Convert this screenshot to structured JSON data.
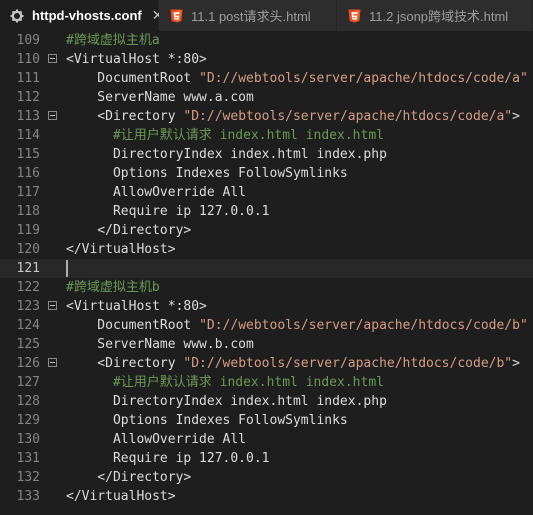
{
  "tabs": [
    {
      "label": "httpd-vhosts.conf",
      "icon": "gear-icon",
      "active": true,
      "close": "✕"
    },
    {
      "label": "11.1 post请求头.html",
      "icon": "html5-icon",
      "active": false
    },
    {
      "label": "11.2 jsonp跨域技术.html",
      "icon": "html5-icon",
      "active": false
    }
  ],
  "colors": {
    "comment": "#6a9955",
    "string": "#d69d85",
    "text": "#dcdcdc",
    "line_number": "#858585",
    "html5_badge": "#e44d26"
  },
  "editor": {
    "lines": [
      {
        "num": "109",
        "segments": [
          {
            "t": "#跨域虚拟主机a",
            "c": "com"
          }
        ]
      },
      {
        "num": "110",
        "fold": true,
        "segments": [
          {
            "t": "<VirtualHost *:80>",
            "c": "tag"
          }
        ]
      },
      {
        "num": "111",
        "segments": [
          {
            "t": "    DocumentRoot ",
            "c": "dir"
          },
          {
            "t": "\"D://webtools/server/apache/htdocs/code/a\"",
            "c": "str"
          }
        ]
      },
      {
        "num": "112",
        "segments": [
          {
            "t": "    ServerName www.a.com",
            "c": "dir"
          }
        ]
      },
      {
        "num": "113",
        "fold": true,
        "segments": [
          {
            "t": "    <Directory ",
            "c": "tag"
          },
          {
            "t": "\"D://webtools/server/apache/htdocs/code/a\"",
            "c": "str"
          },
          {
            "t": ">",
            "c": "tag"
          }
        ]
      },
      {
        "num": "114",
        "segments": [
          {
            "t": "      #让用户默认请求 index.html index.html",
            "c": "com"
          }
        ]
      },
      {
        "num": "115",
        "segments": [
          {
            "t": "      DirectoryIndex index.html index.php",
            "c": "dir"
          }
        ]
      },
      {
        "num": "116",
        "segments": [
          {
            "t": "      Options Indexes FollowSymlinks",
            "c": "dir"
          }
        ]
      },
      {
        "num": "117",
        "segments": [
          {
            "t": "      AllowOverride All",
            "c": "dir"
          }
        ]
      },
      {
        "num": "118",
        "segments": [
          {
            "t": "      Require ip 127.0.0.1",
            "c": "dir"
          }
        ]
      },
      {
        "num": "119",
        "segments": [
          {
            "t": "    </Directory>",
            "c": "tag"
          }
        ]
      },
      {
        "num": "120",
        "segments": [
          {
            "t": "</VirtualHost>",
            "c": "tag"
          }
        ]
      },
      {
        "num": "121",
        "current": true,
        "segments": []
      },
      {
        "num": "122",
        "segments": [
          {
            "t": "#跨域虚拟主机b",
            "c": "com"
          }
        ]
      },
      {
        "num": "123",
        "fold": true,
        "segments": [
          {
            "t": "<VirtualHost *:80>",
            "c": "tag"
          }
        ]
      },
      {
        "num": "124",
        "segments": [
          {
            "t": "    DocumentRoot ",
            "c": "dir"
          },
          {
            "t": "\"D://webtools/server/apache/htdocs/code/b\"",
            "c": "str"
          }
        ]
      },
      {
        "num": "125",
        "segments": [
          {
            "t": "    ServerName www.b.com",
            "c": "dir"
          }
        ]
      },
      {
        "num": "126",
        "fold": true,
        "segments": [
          {
            "t": "    <Directory ",
            "c": "tag"
          },
          {
            "t": "\"D://webtools/server/apache/htdocs/code/b\"",
            "c": "str"
          },
          {
            "t": ">",
            "c": "tag"
          }
        ]
      },
      {
        "num": "127",
        "segments": [
          {
            "t": "      #让用户默认请求 index.html index.html",
            "c": "com"
          }
        ]
      },
      {
        "num": "128",
        "segments": [
          {
            "t": "      DirectoryIndex index.html index.php",
            "c": "dir"
          }
        ]
      },
      {
        "num": "129",
        "segments": [
          {
            "t": "      Options Indexes FollowSymlinks",
            "c": "dir"
          }
        ]
      },
      {
        "num": "130",
        "segments": [
          {
            "t": "      AllowOverride All",
            "c": "dir"
          }
        ]
      },
      {
        "num": "131",
        "segments": [
          {
            "t": "      Require ip 127.0.0.1",
            "c": "dir"
          }
        ]
      },
      {
        "num": "132",
        "segments": [
          {
            "t": "    </Directory>",
            "c": "tag"
          }
        ]
      },
      {
        "num": "133",
        "segments": [
          {
            "t": "</VirtualHost>",
            "c": "tag"
          }
        ]
      }
    ]
  }
}
